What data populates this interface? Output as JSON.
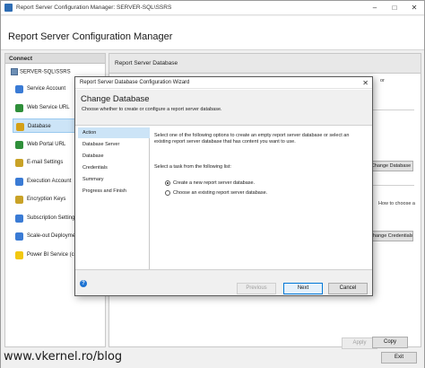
{
  "window": {
    "title": "Report Server Configuration Manager: SERVER-SQL\\SSRS",
    "minimize_glyph": "–",
    "maximize_glyph": "□",
    "close_glyph": "✕",
    "header_title": "Report Server Configuration Manager"
  },
  "sidebar": {
    "connect_label": "Connect",
    "server_name": "SERVER-SQL\\SSRS",
    "items": [
      {
        "label": "Service Account",
        "icon": "service-account-icon",
        "color": "#3a7bd5"
      },
      {
        "label": "Web Service URL",
        "icon": "globe-icon",
        "color": "#2f8f3a"
      },
      {
        "label": "Database",
        "icon": "database-icon",
        "color": "#d4a017"
      },
      {
        "label": "Web Portal URL",
        "icon": "globe-icon",
        "color": "#2f8f3a"
      },
      {
        "label": "E-mail Settings",
        "icon": "email-icon",
        "color": "#c9a227"
      },
      {
        "label": "Execution Account",
        "icon": "user-icon",
        "color": "#3a7bd5"
      },
      {
        "label": "Encryption Keys",
        "icon": "key-icon",
        "color": "#c9a227"
      },
      {
        "label": "Subscription Settings",
        "icon": "subscription-icon",
        "color": "#3a7bd5"
      },
      {
        "label": "Scale-out Deployment",
        "icon": "scale-out-icon",
        "color": "#3a7bd5"
      },
      {
        "label": "Power BI Service (cloud)",
        "icon": "power-bi-icon",
        "color": "#f2c811"
      }
    ],
    "selected_index": 2
  },
  "main": {
    "section_title": "Report Server Database",
    "change_database_label": "Change Database",
    "change_credentials_label": "Change Credentials",
    "fragments": {
      "or": "or",
      "how_to_choose": "How to choose a"
    }
  },
  "wizard": {
    "title": "Report Server Database Configuration Wizard",
    "close_glyph": "✕",
    "heading": "Change Database",
    "subheading": "Choose whether to create or configure a report server database.",
    "steps": [
      "Action",
      "Database Server",
      "Database",
      "Credentials",
      "Summary",
      "Progress and Finish"
    ],
    "active_step": 0,
    "description": "Select one of the following options to create an empty report server database or select an existing report server database that has content you want to use.",
    "task_label": "Select a task from the following list:",
    "options": [
      {
        "label": "Create a new report server database.",
        "checked": true
      },
      {
        "label": "Choose an existing report server database.",
        "checked": false
      }
    ],
    "buttons": {
      "previous": "Previous",
      "next": "Next",
      "cancel": "Cancel"
    },
    "help_glyph": "?"
  },
  "bottom": {
    "apply_label": "Apply",
    "copy_label": "Copy",
    "exit_label": "Exit"
  },
  "watermark": "www.vkernel.ro/blog"
}
